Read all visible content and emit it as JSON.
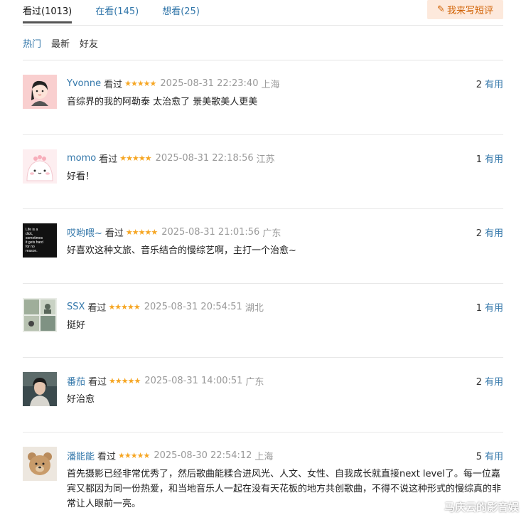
{
  "tabs": [
    {
      "label": "看过(1013)",
      "active": true
    },
    {
      "label": "在看(145)",
      "active": false
    },
    {
      "label": "想看(25)",
      "active": false
    }
  ],
  "write_button": {
    "label": "我来写短评",
    "icon": "pencil-icon"
  },
  "sort_options": [
    {
      "label": "热门",
      "active": true
    },
    {
      "label": "最新",
      "active": false
    },
    {
      "label": "好友",
      "active": false
    }
  ],
  "colors": {
    "link": "#3377aa",
    "star": "#f6a623",
    "write_bg": "#fde9dc",
    "write_fg": "#d06000"
  },
  "comments": [
    {
      "user": "Yvonne",
      "status": "看过",
      "stars": "★★★★★",
      "time": "2025-08-31 22:23:40",
      "location": "上海",
      "votes": "2",
      "useful": "有用",
      "content": "音综界的我的阿勒泰 太治愈了 景美歌美人更美",
      "avatar": "cartoon-girl-avatar"
    },
    {
      "user": "momo",
      "status": "看过",
      "stars": "★★★★★",
      "time": "2025-08-31 22:18:56",
      "location": "江苏",
      "votes": "1",
      "useful": "有用",
      "content": "好看！",
      "avatar": "pink-blob-avatar"
    },
    {
      "user": "哎哟喂~",
      "status": "看过",
      "stars": "★★★★★",
      "time": "2025-08-31 21:01:56",
      "location": "广东",
      "votes": "2",
      "useful": "有用",
      "content": "好喜欢这种文旅、音乐结合的慢综艺啊，主打一个治愈~",
      "avatar": "text-avatar",
      "avatar_text": "Life is a dick, sometimes it gets hard for no reason."
    },
    {
      "user": "SSX",
      "status": "看过",
      "stars": "★★★★★",
      "time": "2025-08-31 20:54:51",
      "location": "湖北",
      "votes": "1",
      "useful": "有用",
      "content": "挺好",
      "avatar": "photo-collage-avatar"
    },
    {
      "user": "番茄",
      "status": "看过",
      "stars": "★★★★★",
      "time": "2025-08-31 14:00:51",
      "location": "广东",
      "votes": "2",
      "useful": "有用",
      "content": "好治愈",
      "avatar": "portrait-avatar"
    },
    {
      "user": "潘能能",
      "status": "看过",
      "stars": "★★★★★",
      "time": "2025-08-30 22:54:12",
      "location": "上海",
      "votes": "5",
      "useful": "有用",
      "content": "首先摄影已经非常优秀了，然后歌曲能糅合进风光、人文、女性、自我成长就直接next level了。每一位嘉宾又都因为同一份热爱，和当地音乐人一起在没有天花板的地方共创歌曲，不得不说这种形式的慢综真的非常让人眼前一亮。",
      "avatar": "teddy-bear-avatar"
    }
  ],
  "watermark": "马庆云的影音娱"
}
